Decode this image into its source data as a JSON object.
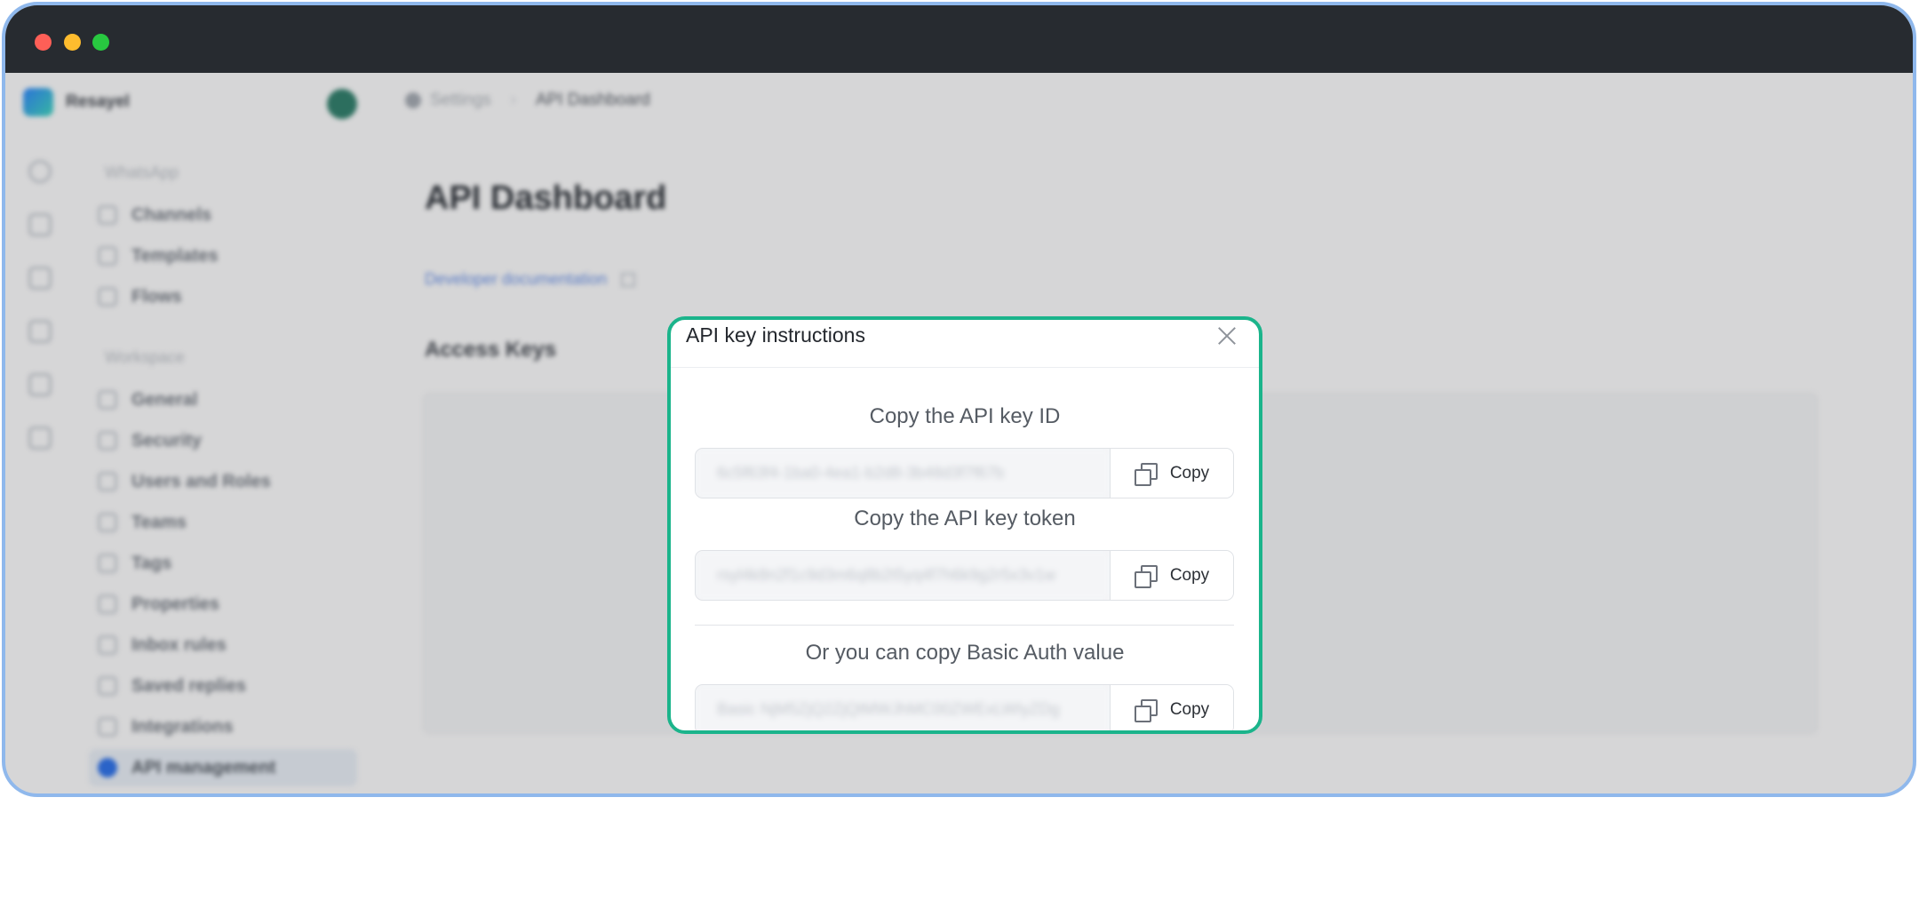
{
  "sidebar": {
    "brand": "Resayel",
    "sections": [
      {
        "label": "WhatsApp",
        "items": [
          "Channels",
          "Templates",
          "Flows"
        ]
      },
      {
        "label": "Workspace",
        "items": [
          "General",
          "Security",
          "Users and Roles",
          "Teams",
          "Tags",
          "Properties",
          "Inbox rules",
          "Saved replies",
          "Integrations",
          "API management"
        ]
      }
    ],
    "active_item": "API management"
  },
  "breadcrumb": {
    "parent": "Settings",
    "separator": "›",
    "current": "API Dashboard"
  },
  "main": {
    "title": "API Dashboard",
    "doc_link": "Developer documentation",
    "access_keys_heading": "Access Keys"
  },
  "modal": {
    "title": "API key instructions",
    "blocks": [
      {
        "label": "Copy the API key ID",
        "value": "6c5f63f4-1ba0-4ea1-b2d8-3b48d3f7f67b",
        "button": "Copy"
      },
      {
        "label": "Copy the API key token",
        "value": "rsyl4k8n2f1c9d3m6q8b2t5yq4f7h6k9g2r5x3v1w",
        "button": "Copy"
      },
      {
        "label": "Or you can copy Basic Auth value",
        "value": "Basic NjM5ZjQ2ZjQtMWJhMC00ZWExLWIyZDg",
        "button": "Copy"
      }
    ]
  },
  "colors": {
    "modal_border": "#1bb48b",
    "window_border": "#8fb8ec",
    "titlebar": "#272b30",
    "link": "#5b7cc4"
  }
}
